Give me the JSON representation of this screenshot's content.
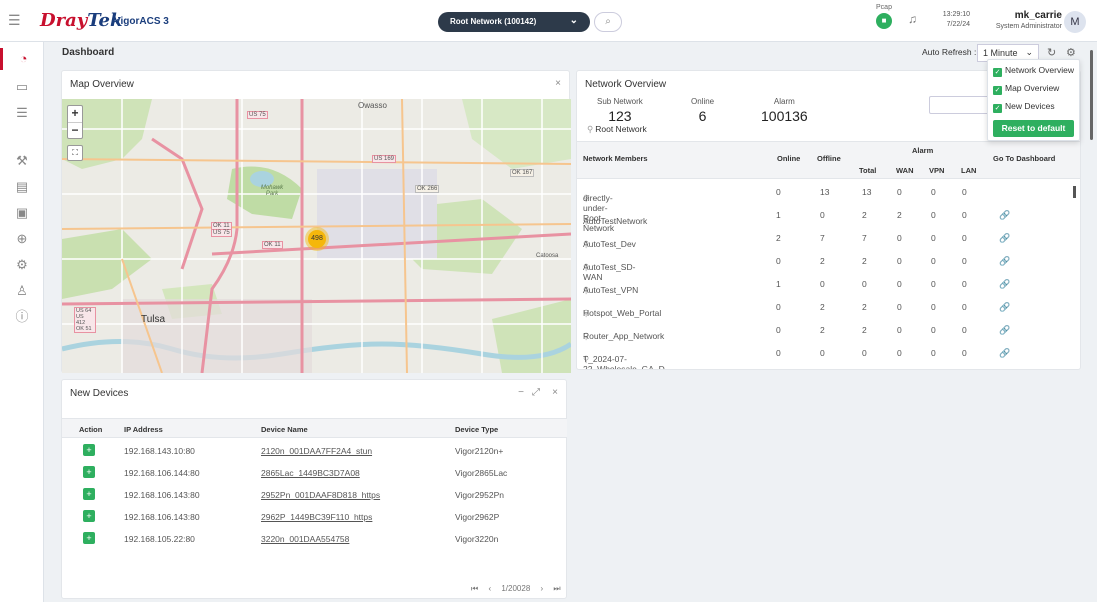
{
  "app": {
    "logo_dray": "Dray",
    "logo_tek": "Tek",
    "product": "VigorACS 3"
  },
  "header": {
    "network_select": "Root Network (100142)",
    "pcap_label": "Pcap",
    "time": "13:29:10",
    "date": "7/22/24",
    "user_name": "mk_carrie",
    "user_role": "System Administrator",
    "avatar_letter": "M"
  },
  "sidebar": {
    "items": [
      {
        "icon": "dashboard-gauge-icon",
        "glyph": "◔"
      },
      {
        "icon": "monitor-icon",
        "glyph": "▭"
      },
      {
        "icon": "sliders-icon",
        "glyph": "☰"
      },
      {
        "icon": "wrench-icon",
        "glyph": "⚒"
      },
      {
        "icon": "clipboard-icon",
        "glyph": "▤"
      },
      {
        "icon": "device-icon",
        "glyph": "▣"
      },
      {
        "icon": "globe-icon",
        "glyph": "⊕"
      },
      {
        "icon": "gear-icon",
        "glyph": "⚙"
      },
      {
        "icon": "users-icon",
        "glyph": "♙"
      },
      {
        "icon": "info-icon",
        "glyph": "ⓘ"
      }
    ]
  },
  "dashboard": {
    "title": "Dashboard",
    "auto_refresh_label": "Auto Refresh :",
    "auto_refresh_value": "1 Minute"
  },
  "settings_menu": {
    "items": [
      "Network Overview",
      "Map Overview",
      "New Devices"
    ],
    "reset_label": "Reset to default"
  },
  "map_overview": {
    "title": "Map Overview",
    "cluster_count": "498",
    "place_labels": [
      "Owasso",
      "Tulsa",
      "Mohawk Park",
      "Catoosa"
    ],
    "road_labels": [
      "US 75",
      "US 169",
      "OK 266",
      "OK 167",
      "OK 11",
      "US 75",
      "OK 11",
      "US 64 US 412 OK 51"
    ]
  },
  "network_overview": {
    "title": "Network Overview",
    "stats": {
      "sub_network_label": "Sub Network",
      "sub_network_value": "123",
      "online_label": "Online",
      "online_value": "6",
      "alarm_label": "Alarm",
      "alarm_value": "100136"
    },
    "root_network": "Root Network",
    "columns": {
      "members": "Network Members",
      "online": "Online",
      "offline": "Offline",
      "alarm": "Alarm",
      "total": "Total",
      "wan": "WAN",
      "vpn": "VPN",
      "lan": "LAN",
      "go_to": "Go To Dashboard"
    },
    "rows": [
      {
        "name": "directly-under-Root Network",
        "online": "0",
        "offline": "13",
        "total": "13",
        "wan": "0",
        "vpn": "0",
        "lan": "0",
        "link": false
      },
      {
        "name": "AutoTestNetwork",
        "online": "1",
        "offline": "0",
        "total": "2",
        "wan": "2",
        "vpn": "0",
        "lan": "0",
        "link": true
      },
      {
        "name": "AutoTest_Dev",
        "online": "2",
        "offline": "7",
        "total": "7",
        "wan": "0",
        "vpn": "0",
        "lan": "0",
        "link": true
      },
      {
        "name": "AutoTest_SD-WAN",
        "online": "0",
        "offline": "2",
        "total": "2",
        "wan": "0",
        "vpn": "0",
        "lan": "0",
        "link": true
      },
      {
        "name": "AutoTest_VPN",
        "online": "1",
        "offline": "0",
        "total": "0",
        "wan": "0",
        "vpn": "0",
        "lan": "0",
        "link": true
      },
      {
        "name": "Hotspot_Web_Portal",
        "online": "0",
        "offline": "2",
        "total": "2",
        "wan": "0",
        "vpn": "0",
        "lan": "0",
        "link": true
      },
      {
        "name": "Router_App_Network",
        "online": "0",
        "offline": "2",
        "total": "2",
        "wan": "0",
        "vpn": "0",
        "lan": "0",
        "link": true
      },
      {
        "name": "T_2024-07-22_Wholesale_GA_D",
        "online": "0",
        "offline": "0",
        "total": "0",
        "wan": "0",
        "vpn": "0",
        "lan": "0",
        "link": true
      }
    ]
  },
  "new_devices": {
    "title": "New Devices",
    "columns": {
      "action": "Action",
      "ip": "IP Address",
      "name": "Device Name",
      "type": "Device Type"
    },
    "rows": [
      {
        "ip": "192.168.143.10:80",
        "name": "2120n_001DAA7FF2A4_stun",
        "type": "Vigor2120n+"
      },
      {
        "ip": "192.168.106.144:80",
        "name": "2865Lac_1449BC3D7A08",
        "type": "Vigor2865Lac"
      },
      {
        "ip": "192.168.106.143:80",
        "name": "2952Pn_001DAAF8D818_https",
        "type": "Vigor2952Pn"
      },
      {
        "ip": "192.168.106.143:80",
        "name": "2962P_1449BC39F110_https",
        "type": "Vigor2962P"
      },
      {
        "ip": "192.168.105.22:80",
        "name": "3220n_001DAA554758",
        "type": "Vigor3220n"
      }
    ],
    "pager": "1/20028"
  },
  "colors": {
    "brand_red": "#c8102e",
    "brand_blue": "#1a3d7c",
    "accent_green": "#2eaf5f",
    "cluster_yellow": "#f5b70b"
  }
}
